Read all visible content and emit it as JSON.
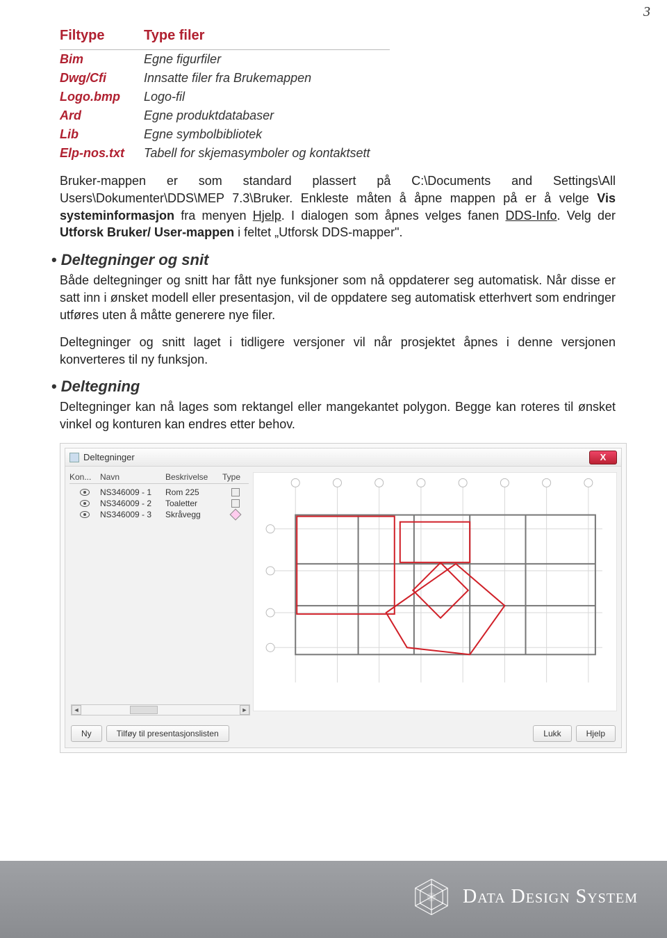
{
  "page_number": "3",
  "table": {
    "head": [
      "Filtype",
      "Type filer"
    ],
    "rows": [
      {
        "name": "Bim",
        "desc": "Egne figurfiler"
      },
      {
        "name": "Dwg/Cfi",
        "desc": "Innsatte filer fra Brukemappen"
      },
      {
        "name": "Logo.bmp",
        "desc": "Logo-fil"
      },
      {
        "name": "Ard",
        "desc": "Egne produktdatabaser"
      },
      {
        "name": "Lib",
        "desc": "Egne symbolbibliotek"
      },
      {
        "name": "Elp-nos.txt",
        "desc": "Tabell for skjemasymboler og kontaktsett"
      }
    ]
  },
  "para1": {
    "t1": "Bruker-mappen er som standard plassert på C:\\Documents and Settings\\All Users\\Dokumenter\\DDS\\MEP 7.3\\Bruker. Enkleste måten å åpne mappen på er å velge ",
    "b1": "Vis systeminformasjon",
    "t2": " fra menyen ",
    "u1": "Hjelp",
    "t3": ". I dialogen som åpnes velges fanen ",
    "u2": "DDS-Info",
    "t4": ". Velg der ",
    "b2": "Utforsk Bruker/ User-mappen",
    "t5": " i feltet „Utforsk DDS-mapper\"."
  },
  "sect1": {
    "title": "Deltegninger og snit",
    "p1": "Både deltegninger og snitt har fått nye funksjoner som nå oppdaterer seg automatisk. Når disse er satt inn i ønsket modell eller presentasjon, vil de oppdatere seg automatisk etterhvert som endringer utføres uten å måtte generere nye filer.",
    "p2": "Deltegninger og snitt laget i tidligere versjoner vil når prosjektet åpnes i denne versjonen konverteres til ny funksjon."
  },
  "sect2": {
    "title": "Deltegning",
    "p1": "Deltegninger kan nå lages som rektangel eller mangekantet polygon. Begge kan roteres til ønsket vinkel og konturen kan endres etter behov."
  },
  "dialog": {
    "title": "Deltegninger",
    "close": "X",
    "cols": {
      "k": "Kon...",
      "n": "Navn",
      "b": "Beskrivelse",
      "t": "Type"
    },
    "rows": [
      {
        "name": "NS346009 - 1",
        "desc": "Rom 225",
        "type": "sq"
      },
      {
        "name": "NS346009 - 2",
        "desc": "Toaletter",
        "type": "sq"
      },
      {
        "name": "NS346009 - 3",
        "desc": "Skråvegg",
        "type": "dia"
      }
    ],
    "arrow_l": "◄",
    "arrow_r": "►",
    "btn_ny": "Ny",
    "btn_tilfoy": "Tilføy til presentasjonslisten",
    "btn_lukk": "Lukk",
    "btn_hjelp": "Hjelp"
  },
  "brand": "Data Design System"
}
